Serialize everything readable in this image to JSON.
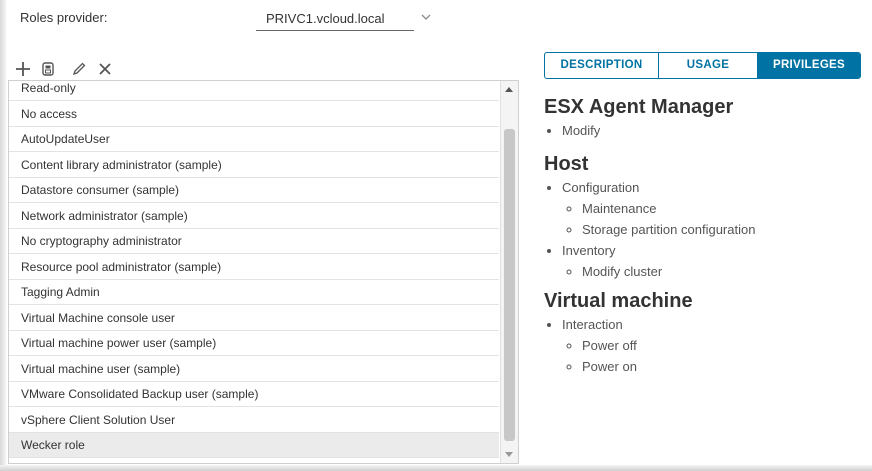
{
  "provider": {
    "label": "Roles provider:",
    "value": "PRIVC1.vcloud.local"
  },
  "toolbar": {
    "buttons": [
      {
        "name": "add-icon"
      },
      {
        "name": "clone-icon"
      },
      {
        "name": "edit-icon"
      },
      {
        "name": "delete-icon"
      }
    ]
  },
  "roles": {
    "items": [
      "Read-only",
      "No access",
      "AutoUpdateUser",
      "Content library administrator (sample)",
      "Datastore consumer (sample)",
      "Network administrator (sample)",
      "No cryptography administrator",
      "Resource pool administrator (sample)",
      "Tagging Admin",
      "Virtual Machine console user",
      "Virtual machine power user (sample)",
      "Virtual machine user (sample)",
      "VMware Consolidated Backup user (sample)",
      "vSphere Client Solution User",
      "Wecker role"
    ],
    "selected": "Wecker role"
  },
  "tabs": {
    "description": "DESCRIPTION",
    "usage": "USAGE",
    "privileges": "PRIVILEGES",
    "active": "PRIVILEGES"
  },
  "privileges": {
    "esx": {
      "title": "ESX Agent Manager",
      "items": [
        "Modify"
      ]
    },
    "host": {
      "title": "Host",
      "configuration": "Configuration",
      "configuration_children": [
        "Maintenance",
        "Storage partition configuration"
      ],
      "inventory": "Inventory",
      "inventory_children": [
        "Modify cluster"
      ]
    },
    "vm": {
      "title": "Virtual machine",
      "interaction": "Interaction",
      "interaction_children": [
        "Power off",
        "Power on"
      ]
    }
  },
  "colors": {
    "accent": "#0072a3",
    "selected_row": "#ebebeb"
  }
}
